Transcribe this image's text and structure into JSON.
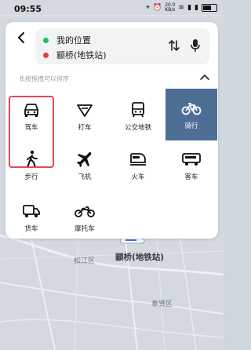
{
  "status": {
    "time": "09:55",
    "data_speed": "20.0\nKB/s",
    "battery": ""
  },
  "route": {
    "start": "我的位置",
    "end": "颛桥(地铁站)"
  },
  "hint": "长按拖拽可以排序",
  "modes": [
    {
      "label": "驾车",
      "icon": "car-icon"
    },
    {
      "label": "打车",
      "icon": "taxi-icon"
    },
    {
      "label": "公交地铁",
      "icon": "bus-icon"
    },
    {
      "label": "骑行",
      "icon": "bike-icon",
      "selected": true
    },
    {
      "label": "步行",
      "icon": "walk-icon"
    },
    {
      "label": "飞机",
      "icon": "plane-icon"
    },
    {
      "label": "火车",
      "icon": "train-icon"
    },
    {
      "label": "客车",
      "icon": "coach-icon"
    },
    {
      "label": "货车",
      "icon": "truck-icon"
    },
    {
      "label": "摩托车",
      "icon": "motorcycle-icon"
    }
  ],
  "map": {
    "labels": {
      "songjiang": "松江区",
      "zhuanqiao": "颛桥(地铁站)",
      "fengxian": "奉贤区"
    }
  },
  "colors": {
    "accent": "#4e6e96",
    "highlight": "#e14b4b",
    "start_dot": "#1dbf66",
    "end_dot": "#ee3b3b"
  }
}
